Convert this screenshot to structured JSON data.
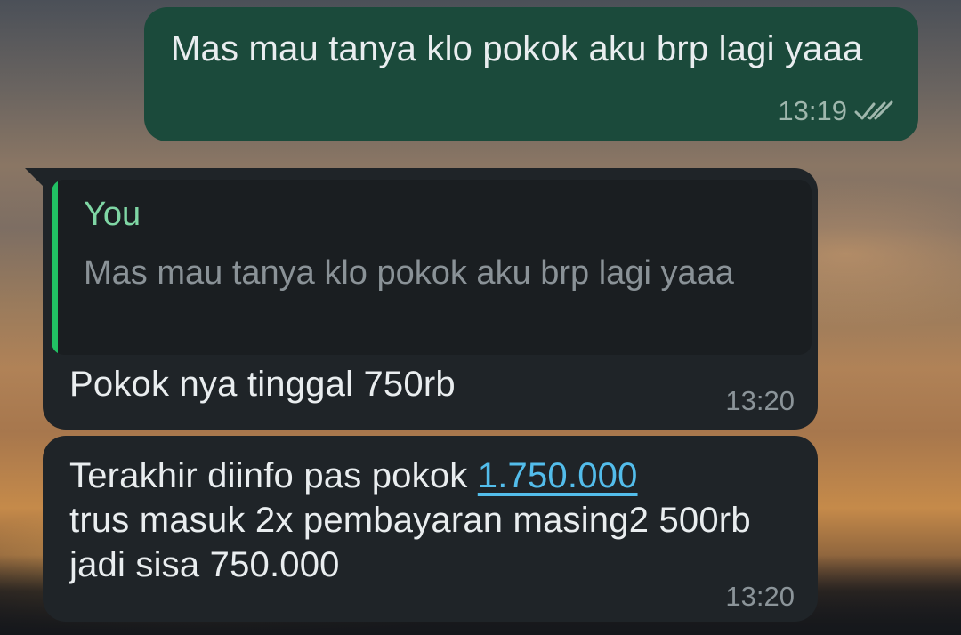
{
  "messages": {
    "outgoing": {
      "text": "Mas mau tanya klo pokok aku brp lagi yaaa",
      "time": "13:19",
      "status_icon": "double-check-icon"
    },
    "reply": {
      "quote_author": "You",
      "quote_text": "Mas mau tanya klo pokok aku brp lagi yaaa",
      "text": "Pokok nya tinggal 750rb",
      "time": "13:20"
    },
    "incoming": {
      "text_before_link": "Terakhir diinfo pas pokok ",
      "link_text": "1.750.000",
      "text_after_link": "trus masuk 2x pembayaran masing2 500rb jadi sisa 750.000",
      "time": "13:20"
    }
  },
  "colors": {
    "outgoing_bubble": "#1b4a3b",
    "incoming_bubble": "#1f2428",
    "quote_accent": "#21c063",
    "link": "#53bdeb"
  }
}
